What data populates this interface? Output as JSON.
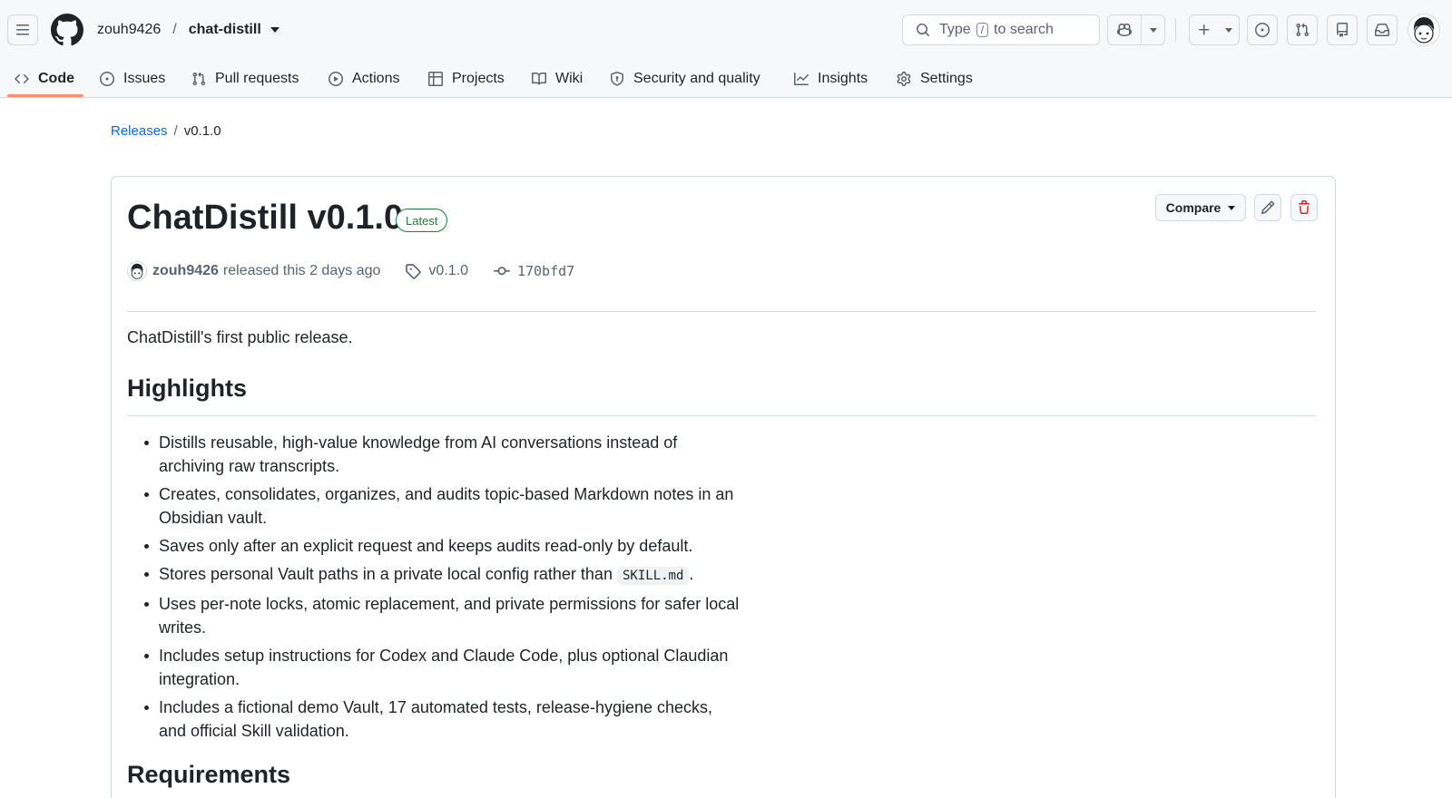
{
  "header": {
    "owner": "zouh9426",
    "separator": "/",
    "repo": "chat-distill",
    "search": {
      "prefix": "Type",
      "key": "/",
      "suffix": "to search"
    },
    "icons": [
      "hamburger-icon",
      "github-mark-icon",
      "search-icon",
      "copilot-icon",
      "plus-icon",
      "issue-icon",
      "pull-request-icon",
      "repo-icon",
      "inbox-icon"
    ]
  },
  "tabs": [
    {
      "label": "Code",
      "icon": "code-icon",
      "active": true
    },
    {
      "label": "Issues",
      "icon": "issue-icon"
    },
    {
      "label": "Pull requests",
      "icon": "pull-request-icon"
    },
    {
      "label": "Actions",
      "icon": "play-icon"
    },
    {
      "label": "Projects",
      "icon": "table-icon"
    },
    {
      "label": "Wiki",
      "icon": "book-icon"
    },
    {
      "label": "Security and quality",
      "icon": "shield-icon"
    },
    {
      "label": "Insights",
      "icon": "graph-icon"
    },
    {
      "label": "Settings",
      "icon": "gear-icon"
    }
  ],
  "breadcrumb": {
    "link": "Releases",
    "sep": "/",
    "current": "v0.1.0"
  },
  "release": {
    "title": "ChatDistill v0.1.0",
    "badge": "Latest",
    "compare_label": "Compare",
    "author": "zouh9426",
    "released_text": "released this 2 days ago",
    "tag": "v0.1.0",
    "commit": "170bfd7",
    "intro": "ChatDistill's first public release.",
    "highlights_heading": "Highlights",
    "highlights": [
      "Distills reusable, high-value knowledge from AI conversations instead of archiving raw transcripts.",
      "Creates, consolidates, organizes, and audits topic-based Markdown notes in an Obsidian vault.",
      "Saves only after an explicit request and keeps audits read-only by default.",
      {
        "before": "Stores personal Vault paths in a private local config rather than",
        "code": "SKILL.md",
        "after": "."
      },
      "Uses per-note locks, atomic replacement, and private permissions for safer local writes.",
      "Includes setup instructions for Codex and Claude Code, plus optional Claudian integration.",
      "Includes a fictional demo Vault, 17 automated tests, release-hygiene checks, and official Skill validation."
    ],
    "requirements_heading": "Requirements"
  },
  "colors": {
    "accent": "#0969da",
    "latest": "#1a7f37",
    "danger": "#d1242f",
    "tab_underline": "#fd8c73"
  }
}
